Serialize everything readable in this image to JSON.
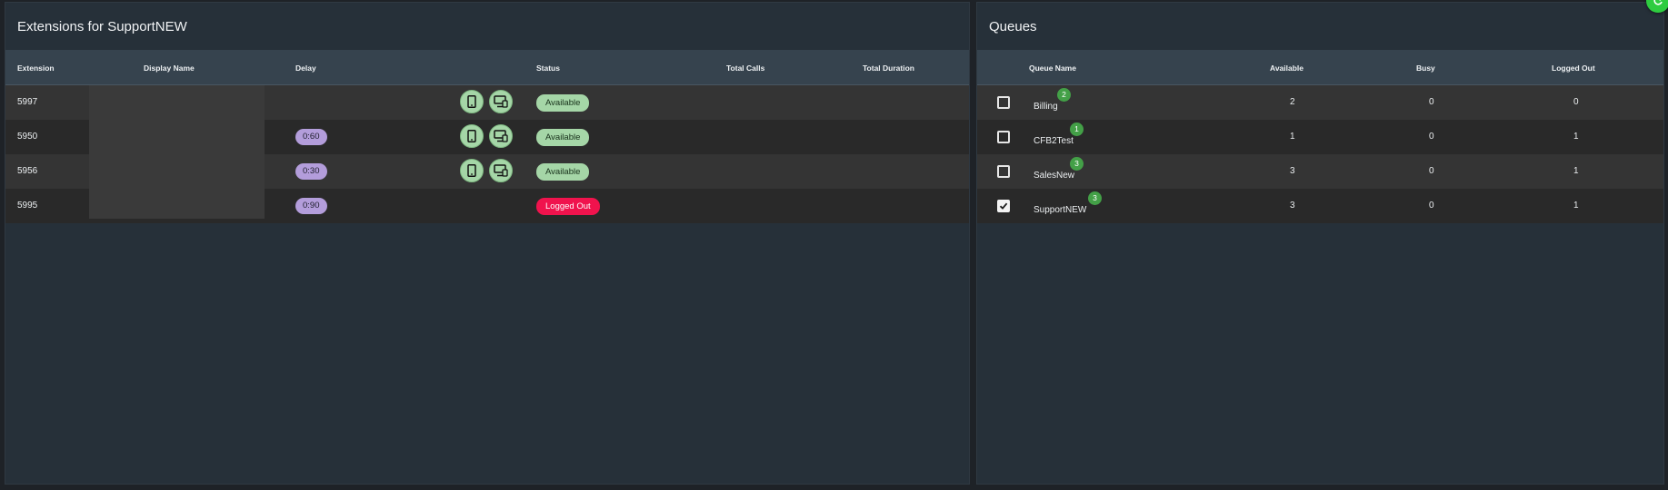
{
  "extensions_panel": {
    "title": "Extensions for SupportNEW",
    "columns": [
      "Extension",
      "Display Name",
      "Delay",
      "Status",
      "Total Calls",
      "Total Duration"
    ],
    "rows": [
      {
        "extension": "5997",
        "display_name": "",
        "delay": "",
        "status": "Available",
        "status_kind": "available",
        "show_device_icons": true
      },
      {
        "extension": "5950",
        "display_name": "",
        "delay": "0:60",
        "status": "Available",
        "status_kind": "available",
        "show_device_icons": true
      },
      {
        "extension": "5956",
        "display_name": "",
        "delay": "0:30",
        "status": "Available",
        "status_kind": "available",
        "show_device_icons": true
      },
      {
        "extension": "5995",
        "display_name": "",
        "delay": "0:90",
        "status": "Logged Out",
        "status_kind": "logged-out",
        "show_device_icons": false
      }
    ],
    "icons": {
      "phone": "mobile-phone-icon",
      "desk": "desktop-phone-icon"
    }
  },
  "queues_panel": {
    "title": "Queues",
    "columns": [
      "Queue Name",
      "Available",
      "Busy",
      "Logged Out"
    ],
    "rows": [
      {
        "name": "Billing",
        "badge": "2",
        "checked": false,
        "available": "2",
        "busy": "0",
        "logged_out": "0"
      },
      {
        "name": "CFB2Test",
        "badge": "1",
        "checked": false,
        "available": "1",
        "busy": "0",
        "logged_out": "1"
      },
      {
        "name": "SalesNew",
        "badge": "3",
        "checked": false,
        "available": "3",
        "busy": "0",
        "logged_out": "1"
      },
      {
        "name": "SupportNEW",
        "badge": "3",
        "checked": true,
        "available": "3",
        "busy": "0",
        "logged_out": "1"
      }
    ]
  },
  "colors": {
    "panel_bg": "#263039",
    "header_bg": "#36434e",
    "available": "#a5d6a7",
    "logged_out": "#f0134d",
    "delay": "#b39ddb",
    "badge": "#43a047",
    "fab": "#2ecc40"
  },
  "fab": {
    "icon": "refresh-icon"
  }
}
